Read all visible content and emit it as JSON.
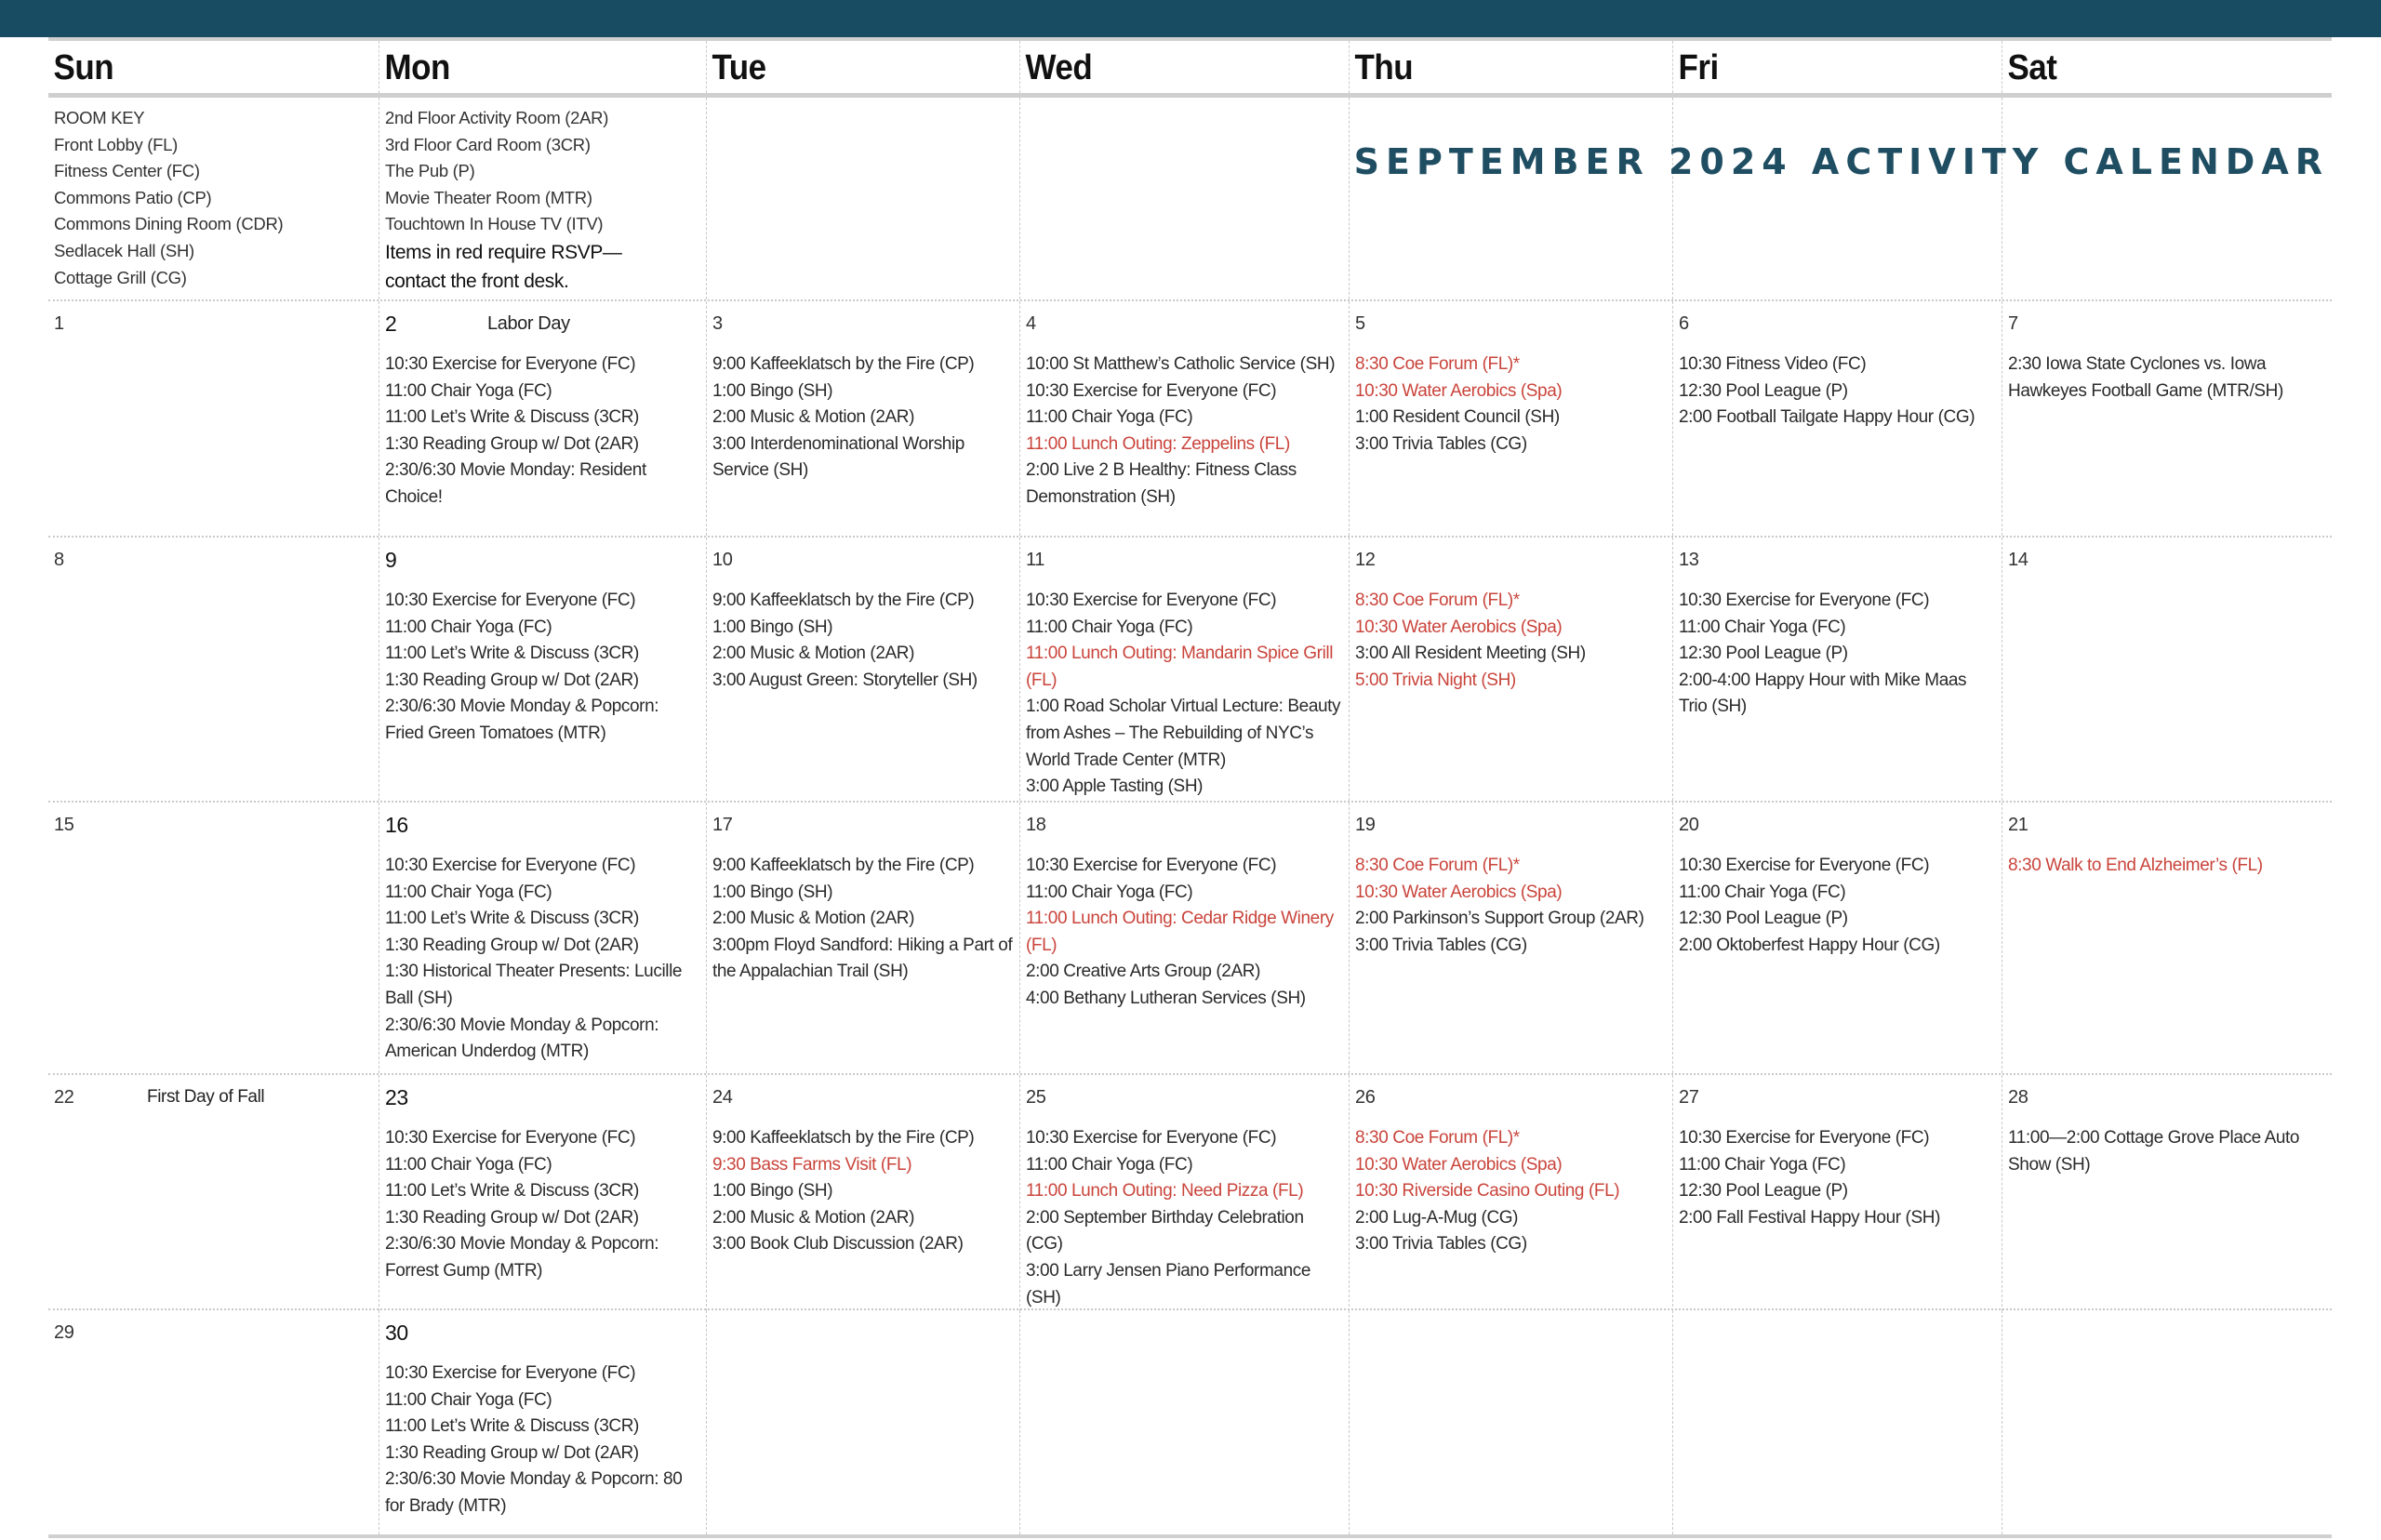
{
  "title": "SEPTEMBER 2024 ACTIVITY CALENDAR",
  "colors": {
    "header_bar": "#174c62",
    "title": "#1f4e63",
    "rsvp_red": "#c9443b"
  },
  "weekdays": [
    "Sun",
    "Mon",
    "Tue",
    "Wed",
    "Thu",
    "Fri",
    "Sat"
  ],
  "room_key": {
    "col1": [
      "ROOM KEY",
      "Front Lobby (FL)",
      "Fitness Center (FC)",
      "Commons Patio (CP)",
      "Commons Dining Room (CDR)",
      "Sedlacek Hall (SH)",
      "Cottage Grill (CG)"
    ],
    "col2": [
      "2nd Floor Activity Room (2AR)",
      "3rd Floor Card Room (3CR)",
      "The Pub (P)",
      "Movie Theater Room (MTR)",
      "Touchtown In House TV (ITV)"
    ],
    "note": [
      "Items in red require RSVP—",
      "contact the front desk."
    ]
  },
  "weeks": [
    {
      "days": [
        {
          "day": "1",
          "events": []
        },
        {
          "day": "2",
          "holiday": "Labor Day",
          "events": [
            {
              "text": "10:30 Exercise for Everyone (FC)"
            },
            {
              "text": "11:00 Chair Yoga (FC)"
            },
            {
              "text": "11:00 Let’s Write & Discuss (3CR)"
            },
            {
              "text": "1:30 Reading Group w/ Dot (2AR)"
            },
            {
              "text": "2:30/6:30 Movie Monday: Resident Choice!"
            }
          ]
        },
        {
          "day": "3",
          "events": [
            {
              "text": "9:00 Kaffeeklatsch by the Fire (CP)"
            },
            {
              "text": "1:00 Bingo (SH)"
            },
            {
              "text": "2:00 Music & Motion (2AR)"
            },
            {
              "text": "3:00 Interdenominational Worship Service (SH)"
            }
          ]
        },
        {
          "day": "4",
          "events": [
            {
              "text": "10:00 St Matthew’s Catholic Service (SH)"
            },
            {
              "text": "10:30 Exercise for Everyone (FC)"
            },
            {
              "text": "11:00 Chair Yoga (FC)"
            },
            {
              "text": "11:00 Lunch Outing: Zeppelins (FL)",
              "rsvp": true
            },
            {
              "text": "2:00 Live 2 B Healthy: Fitness Class Demonstration (SH)"
            }
          ]
        },
        {
          "day": "5",
          "events": [
            {
              "text": "8:30 Coe Forum (FL)*",
              "rsvp": true
            },
            {
              "text": "10:30 Water Aerobics (Spa)",
              "rsvp": true
            },
            {
              "text": "1:00 Resident Council (SH)"
            },
            {
              "text": "3:00 Trivia Tables (CG)"
            }
          ]
        },
        {
          "day": "6",
          "events": [
            {
              "text": "10:30 Fitness Video (FC)"
            },
            {
              "text": "12:30 Pool League (P)"
            },
            {
              "text": "2:00 Football Tailgate Happy Hour (CG)"
            }
          ]
        },
        {
          "day": "7",
          "events": [
            {
              "text": "2:30 Iowa State Cyclones vs. Iowa Hawkeyes Football Game (MTR/SH)"
            }
          ]
        }
      ]
    },
    {
      "days": [
        {
          "day": "8",
          "events": []
        },
        {
          "day": "9",
          "events": [
            {
              "text": "10:30 Exercise for Everyone (FC)"
            },
            {
              "text": "11:00 Chair Yoga (FC)"
            },
            {
              "text": "11:00 Let’s Write & Discuss (3CR)"
            },
            {
              "text": "1:30 Reading Group w/ Dot (2AR)"
            },
            {
              "text": "2:30/6:30 Movie Monday & Popcorn: Fried Green Tomatoes (MTR)"
            }
          ]
        },
        {
          "day": "10",
          "events": [
            {
              "text": "9:00 Kaffeeklatsch by the Fire (CP)"
            },
            {
              "text": "1:00 Bingo (SH)"
            },
            {
              "text": "2:00 Music & Motion (2AR)"
            },
            {
              "text": "3:00 August Green: Storyteller (SH)"
            }
          ]
        },
        {
          "day": "11",
          "events": [
            {
              "text": "10:30 Exercise for Everyone (FC)"
            },
            {
              "text": "11:00 Chair Yoga (FC)"
            },
            {
              "text": "11:00 Lunch Outing: Mandarin Spice Grill (FL)",
              "rsvp": true
            },
            {
              "text": "1:00 Road Scholar Virtual Lecture: Beauty from Ashes – The Rebuilding of NYC’s World Trade Center (MTR)"
            },
            {
              "text": "3:00 Apple Tasting (SH)"
            }
          ]
        },
        {
          "day": "12",
          "events": [
            {
              "text": "8:30 Coe Forum (FL)*",
              "rsvp": true
            },
            {
              "text": "10:30 Water Aerobics (Spa)",
              "rsvp": true
            },
            {
              "text": "3:00 All Resident Meeting (SH)"
            },
            {
              "text": "5:00 Trivia Night (SH)",
              "rsvp": true
            }
          ]
        },
        {
          "day": "13",
          "events": [
            {
              "text": "10:30 Exercise for Everyone (FC)"
            },
            {
              "text": "11:00 Chair Yoga (FC)"
            },
            {
              "text": "12:30 Pool League (P)"
            },
            {
              "text": "2:00-4:00 Happy Hour with Mike Maas Trio (SH)"
            }
          ]
        },
        {
          "day": "14",
          "events": []
        }
      ]
    },
    {
      "days": [
        {
          "day": "15",
          "events": []
        },
        {
          "day": "16",
          "events": [
            {
              "text": "10:30 Exercise for Everyone (FC)"
            },
            {
              "text": "11:00 Chair Yoga (FC)"
            },
            {
              "text": "11:00 Let’s Write & Discuss (3CR)"
            },
            {
              "text": "1:30 Reading Group w/ Dot (2AR)"
            },
            {
              "text": "1:30 Historical Theater Presents: Lucille Ball (SH)"
            },
            {
              "text": "2:30/6:30 Movie Monday & Popcorn: American Underdog (MTR)"
            }
          ]
        },
        {
          "day": "17",
          "events": [
            {
              "text": "9:00 Kaffeeklatsch by the Fire (CP)"
            },
            {
              "text": "1:00 Bingo (SH)"
            },
            {
              "text": "2:00 Music & Motion (2AR)"
            },
            {
              "text": "3:00pm Floyd Sandford: Hiking a Part of the Appalachian Trail (SH)"
            }
          ]
        },
        {
          "day": "18",
          "events": [
            {
              "text": "10:30 Exercise for Everyone (FC)"
            },
            {
              "text": "11:00 Chair Yoga (FC)"
            },
            {
              "text": "11:00 Lunch Outing: Cedar Ridge Winery (FL)",
              "rsvp": true
            },
            {
              "text": "2:00 Creative Arts Group (2AR)"
            },
            {
              "text": "4:00 Bethany Lutheran Services (SH)"
            }
          ]
        },
        {
          "day": "19",
          "events": [
            {
              "text": "8:30 Coe Forum (FL)*",
              "rsvp": true
            },
            {
              "text": "10:30 Water Aerobics (Spa)",
              "rsvp": true
            },
            {
              "text": "2:00 Parkinson’s  Support Group (2AR)"
            },
            {
              "text": "3:00 Trivia Tables (CG)"
            }
          ]
        },
        {
          "day": "20",
          "events": [
            {
              "text": "10:30 Exercise for Everyone (FC)"
            },
            {
              "text": "11:00 Chair Yoga (FC)"
            },
            {
              "text": "12:30 Pool League (P)"
            },
            {
              "text": "2:00 Oktoberfest Happy Hour (CG)"
            }
          ]
        },
        {
          "day": "21",
          "events": [
            {
              "text": "8:30 Walk to End Alzheimer’s (FL)",
              "rsvp": true
            }
          ]
        }
      ]
    },
    {
      "days": [
        {
          "day": "22",
          "holiday": "First Day of Fall",
          "events": []
        },
        {
          "day": "23",
          "events": [
            {
              "text": "10:30 Exercise for Everyone (FC)"
            },
            {
              "text": "11:00 Chair Yoga (FC)"
            },
            {
              "text": "11:00 Let’s Write & Discuss (3CR)"
            },
            {
              "text": "1:30 Reading Group w/ Dot (2AR)"
            },
            {
              "text": "2:30/6:30 Movie Monday & Popcorn: Forrest Gump (MTR)"
            }
          ]
        },
        {
          "day": "24",
          "events": [
            {
              "text": "9:00 Kaffeeklatsch by the Fire (CP)"
            },
            {
              "text": "9:30 Bass Farms Visit (FL)",
              "rsvp": true
            },
            {
              "text": "1:00 Bingo (SH)"
            },
            {
              "text": "2:00 Music & Motion (2AR)"
            },
            {
              "text": "3:00 Book Club Discussion (2AR)"
            }
          ]
        },
        {
          "day": "25",
          "events": [
            {
              "text": "10:30 Exercise for Everyone (FC)"
            },
            {
              "text": "11:00 Chair Yoga (FC)"
            },
            {
              "text": "11:00 Lunch Outing: Need Pizza (FL)",
              "rsvp": true
            },
            {
              "text": "2:00 September Birthday Celebration (CG)"
            },
            {
              "text": "3:00 Larry Jensen Piano Performance (SH)"
            }
          ]
        },
        {
          "day": "26",
          "events": [
            {
              "text": "8:30 Coe Forum (FL)*",
              "rsvp": true
            },
            {
              "text": "10:30 Water Aerobics (Spa)",
              "rsvp": true
            },
            {
              "text": "10:30 Riverside Casino Outing (FL)",
              "rsvp": true
            },
            {
              "text": "2:00 Lug-A-Mug (CG)"
            },
            {
              "text": "3:00 Trivia Tables (CG)"
            }
          ]
        },
        {
          "day": "27",
          "events": [
            {
              "text": "10:30 Exercise for Everyone (FC)"
            },
            {
              "text": "11:00 Chair Yoga (FC)"
            },
            {
              "text": "12:30 Pool League (P)"
            },
            {
              "text": "2:00 Fall Festival Happy Hour (SH)"
            }
          ]
        },
        {
          "day": "28",
          "events": [
            {
              "text": "11:00—2:00 Cottage Grove Place Auto Show (SH)"
            }
          ]
        }
      ]
    },
    {
      "days": [
        {
          "day": "29",
          "events": []
        },
        {
          "day": "30",
          "events": [
            {
              "text": "10:30 Exercise for Everyone (FC)"
            },
            {
              "text": "11:00 Chair Yoga (FC)"
            },
            {
              "text": "11:00 Let’s Write & Discuss (3CR)"
            },
            {
              "text": "1:30 Reading Group w/ Dot (2AR)"
            },
            {
              "text": "2:30/6:30 Movie Monday & Popcorn: 80 for Brady (MTR)"
            }
          ]
        },
        {
          "day": "",
          "events": []
        },
        {
          "day": "",
          "events": []
        },
        {
          "day": "",
          "events": []
        },
        {
          "day": "",
          "events": []
        },
        {
          "day": "",
          "events": []
        }
      ]
    }
  ]
}
